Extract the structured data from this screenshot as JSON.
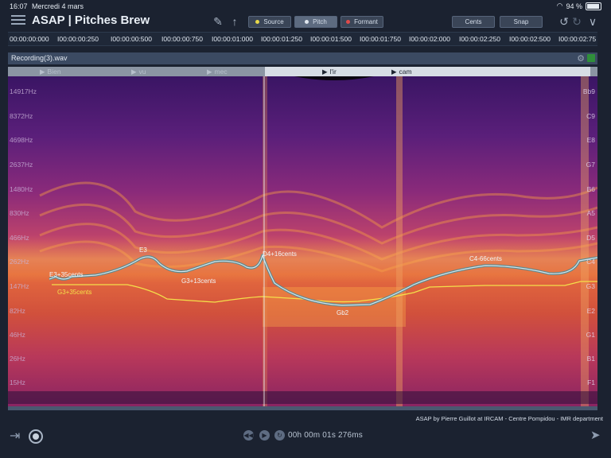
{
  "status": {
    "time": "16:07",
    "date": "Mercredi 4 mars",
    "battery": "94 %",
    "battery_level": 0.94
  },
  "app": {
    "title": "ASAP | Pitches Brew"
  },
  "toolbar": {
    "source_label": "Source",
    "source_color": "#e8d84a",
    "pitch_label": "Pitch",
    "pitch_color": "#dfe6ee",
    "formant_label": "Formant",
    "formant_color": "#e04a4a",
    "cents_label": "Cents",
    "snap_label": "Snap"
  },
  "timeline": {
    "ticks": [
      "00:00:00:000",
      "I00:00:00:250",
      "I00:00:00:500",
      "I00:00:00:750",
      "I00:00:01:000",
      "I00:00:01:250",
      "I00:00:01:500",
      "I00:00:01:750",
      "I00:00:02:000",
      "I00:00:02:250",
      "I00:00:02:500",
      "I00:00:02:75"
    ]
  },
  "track": {
    "name": "Recording(3).wav"
  },
  "segments": [
    {
      "label": "Bien",
      "active": false
    },
    {
      "label": "vu",
      "active": false
    },
    {
      "label": "mec",
      "active": false
    },
    {
      "label": "l'ir",
      "active": true
    },
    {
      "label": "cam",
      "active": true
    }
  ],
  "frequency_labels": [
    "14917Hz",
    "8372Hz",
    "4698Hz",
    "2637Hz",
    "1480Hz",
    "830Hz",
    "466Hz",
    "262Hz",
    "147Hz",
    "82Hz",
    "46Hz",
    "26Hz",
    "15Hz"
  ],
  "note_labels": [
    "Bb9",
    "C9",
    "E8",
    "G7",
    "B6",
    "A5",
    "D5",
    "C4",
    "G3",
    "E2",
    "G1",
    "B1",
    "F1"
  ],
  "pitch_labels": [
    "E3+35cents",
    "E3",
    "G3+13cents",
    "D4+16cents",
    "C4-66cents",
    "Gb2"
  ],
  "source_labels": [
    "G3+35cents"
  ],
  "footer": {
    "credits": "ASAP by Pierre Guillot at IRCAM - Centre Pompidou - IMR department",
    "timecode": "00h 00m 01s 276ms"
  }
}
